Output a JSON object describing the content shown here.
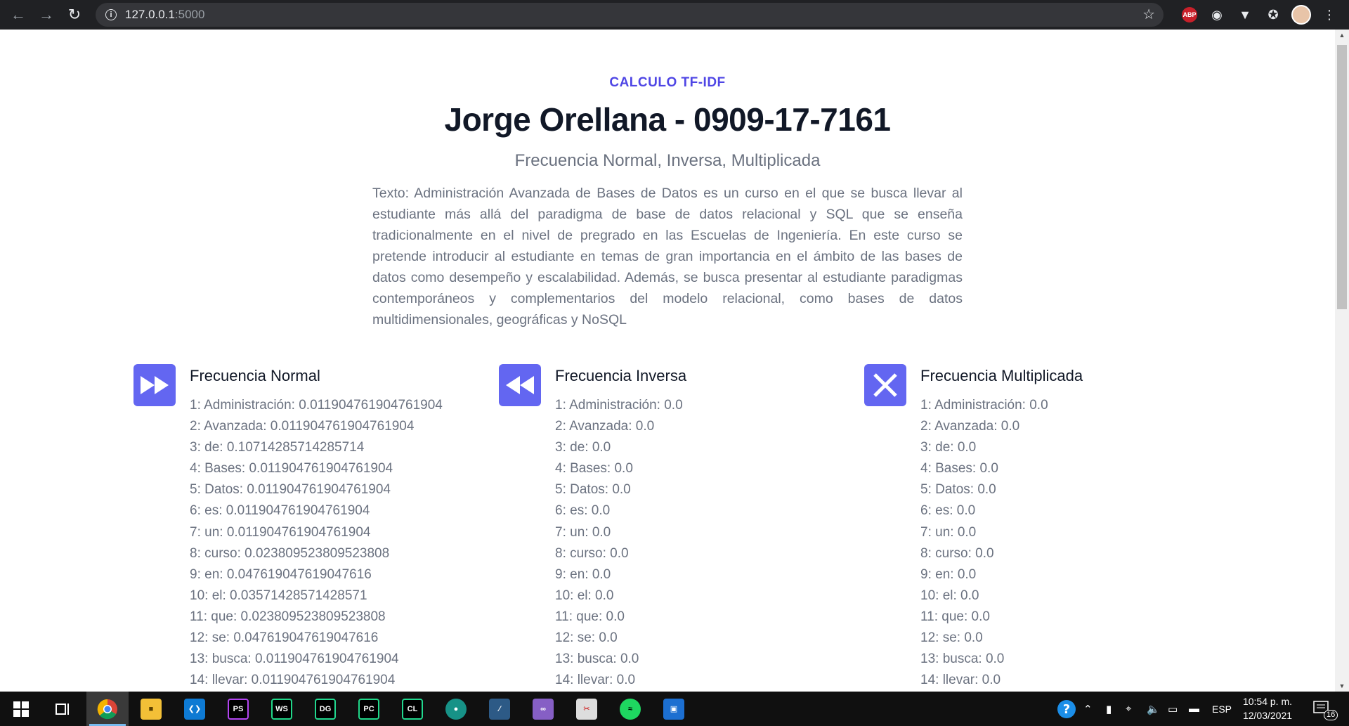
{
  "browser": {
    "url_host": "127.0.0.1",
    "url_port": ":5000",
    "abp_label": "ABP"
  },
  "header": {
    "eyebrow": "CALCULO TF-IDF",
    "title": "Jorge Orellana - 0909-17-7161",
    "subtitle": "Frecuencia Normal, Inversa, Multiplicada"
  },
  "text": "Texto: Administración Avanzada de Bases de Datos es un curso en el que se busca llevar al estudiante más allá del paradigma de base de datos relacional y SQL que se enseña tradicionalmente en el nivel de pregrado en las Escuelas de Ingeniería. En este curso se pretende introducir al estudiante en temas de gran importancia en el ámbito de las bases de datos como desempeño y escalabilidad. Además, se busca presentar al estudiante paradigmas contemporáneos y complementarios del modelo relacional, como bases de datos multidimensionales, geográficas y NoSQL",
  "sections": [
    {
      "title": "Frecuencia Normal",
      "icon": "fast-forward-icon",
      "items": [
        "1: Administración: 0.011904761904761904",
        "2: Avanzada: 0.011904761904761904",
        "3: de: 0.10714285714285714",
        "4: Bases: 0.011904761904761904",
        "5: Datos: 0.011904761904761904",
        "6: es: 0.011904761904761904",
        "7: un: 0.011904761904761904",
        "8: curso: 0.023809523809523808",
        "9: en: 0.047619047619047616",
        "10: el: 0.03571428571428571",
        "11: que: 0.023809523809523808",
        "12: se: 0.047619047619047616",
        "13: busca: 0.011904761904761904",
        "14: llevar: 0.011904761904761904"
      ]
    },
    {
      "title": "Frecuencia Inversa",
      "icon": "rewind-icon",
      "items": [
        "1: Administración: 0.0",
        "2: Avanzada: 0.0",
        "3: de: 0.0",
        "4: Bases: 0.0",
        "5: Datos: 0.0",
        "6: es: 0.0",
        "7: un: 0.0",
        "8: curso: 0.0",
        "9: en: 0.0",
        "10: el: 0.0",
        "11: que: 0.0",
        "12: se: 0.0",
        "13: busca: 0.0",
        "14: llevar: 0.0"
      ]
    },
    {
      "title": "Frecuencia Multiplicada",
      "icon": "multiply-x-icon",
      "items": [
        "1: Administración: 0.0",
        "2: Avanzada: 0.0",
        "3: de: 0.0",
        "4: Bases: 0.0",
        "5: Datos: 0.0",
        "6: es: 0.0",
        "7: un: 0.0",
        "8: curso: 0.0",
        "9: en: 0.0",
        "10: el: 0.0",
        "11: que: 0.0",
        "12: se: 0.0",
        "13: busca: 0.0",
        "14: llevar: 0.0"
      ]
    }
  ],
  "taskbar": {
    "apps": [
      "Chrome",
      "File Explorer",
      "VS Code",
      "PhpStorm",
      "WebStorm",
      "DataGrip",
      "PyCharm",
      "CLion",
      "GitKraken",
      "MySQL Workbench",
      "Visual Studio",
      "Snipping Tool",
      "Spotify",
      "Remote Desktop"
    ],
    "lang": "ESP",
    "time": "10:54 p. m.",
    "date": "12/03/2021",
    "notifications": "16"
  },
  "colors": {
    "accent": "#6366f1",
    "eyebrow": "#4f46e5",
    "title": "#111827",
    "muted": "#6b7280"
  }
}
